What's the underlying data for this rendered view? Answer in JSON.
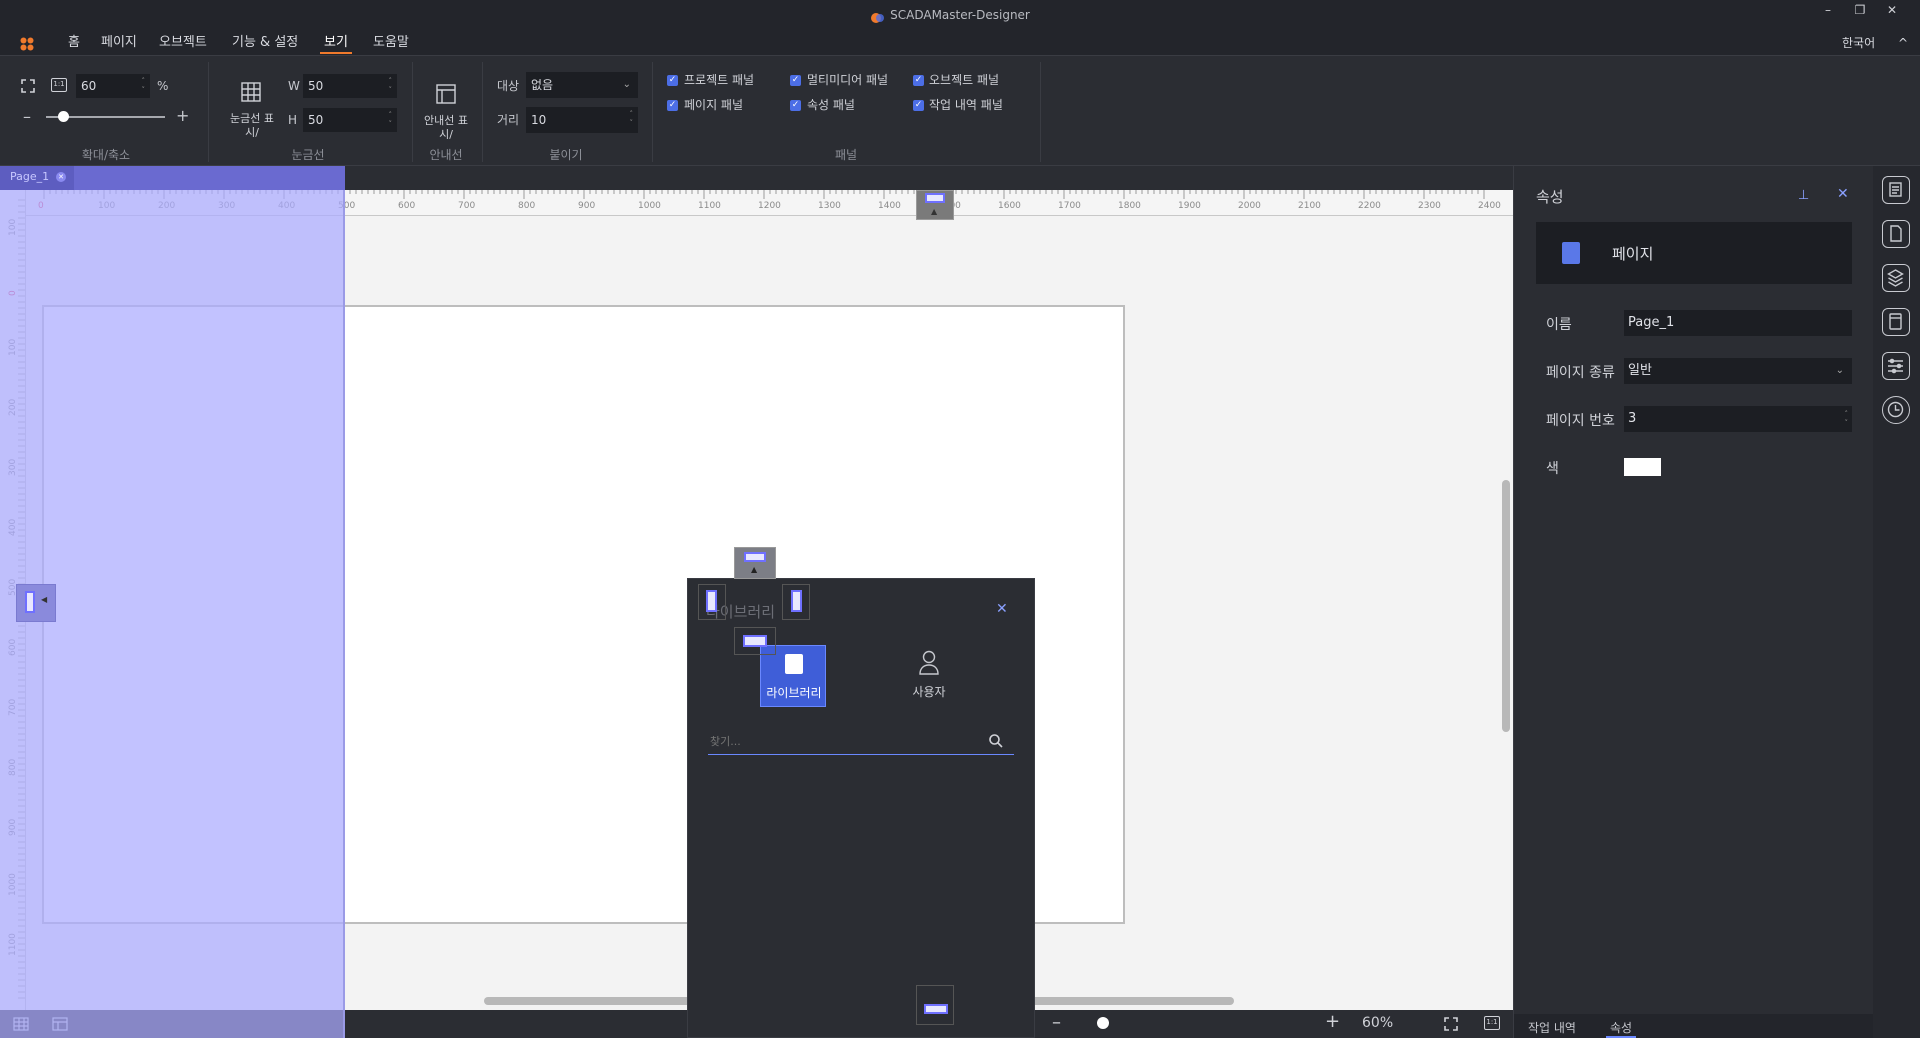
{
  "window": {
    "title": "SCADAMaster-Designer",
    "minimize": "–",
    "restore": "❐",
    "close": "✕"
  },
  "menu": {
    "items": [
      "홈",
      "페이지",
      "오브젝트",
      "기능 & 설정",
      "보기",
      "도움말"
    ],
    "active": "보기",
    "language": "한국어",
    "collapse": "^"
  },
  "ribbon": {
    "zoom": {
      "value": "60",
      "unit": "%",
      "minus": "–",
      "plus": "+",
      "group_label": "확대/축소",
      "fit_label": "1:1"
    },
    "grid": {
      "toggle_label": "눈금선 표시/",
      "w_label": "W",
      "w_value": "50",
      "h_label": "H",
      "h_value": "50",
      "group_label": "눈금선"
    },
    "guide": {
      "toggle_label": "안내선 표시/",
      "group_label": "안내선"
    },
    "snap": {
      "target_label": "대상",
      "target_value": "없음",
      "distance_label": "거리",
      "distance_value": "10",
      "group_label": "붙이기"
    },
    "panels": {
      "group_label": "패널",
      "items": [
        "프로젝트 패널",
        "멀티미디어 패널",
        "오브젝트 패널",
        "페이지 패널",
        "속성 패널",
        "작업 내역 패널"
      ]
    }
  },
  "document": {
    "tab_label": "Page_1",
    "ruler_top": [
      "0",
      "100",
      "200",
      "300",
      "400",
      "500",
      "600",
      "700",
      "800",
      "900",
      "1000",
      "1100",
      "1200",
      "1300",
      "1400",
      "1500",
      "1600",
      "1700",
      "1800",
      "1900",
      "2000",
      "2100",
      "2200",
      "2300",
      "2400"
    ],
    "ruler_left": [
      "100",
      "0",
      "100",
      "200",
      "300",
      "400",
      "500",
      "600",
      "700",
      "800",
      "900",
      "1000",
      "1100"
    ]
  },
  "library_dialog": {
    "title": "라이브러리",
    "tabs": [
      "라이브러리",
      "사용자"
    ],
    "active_tab": "라이브러리",
    "search_placeholder": "찾기..."
  },
  "status": {
    "zoom_text": "60%",
    "minus": "–",
    "plus": "+",
    "fit_label": "1:1",
    "zoom_fraction": 0.6
  },
  "properties": {
    "title": "속성",
    "object_type": "페이지",
    "fields": [
      {
        "label": "이름",
        "value": "Page_1"
      },
      {
        "label": "페이지 종류",
        "value": "일반"
      },
      {
        "label": "페이지 번호",
        "value": "3"
      },
      {
        "label": "색",
        "value": ""
      }
    ],
    "color_value": "#ffffff",
    "bottom_tabs": [
      "작업 내역",
      "속성"
    ]
  },
  "colors": {
    "accent": "#f07a2c",
    "highlight": "#4c6ee6",
    "overlay": "#aaaaff"
  }
}
